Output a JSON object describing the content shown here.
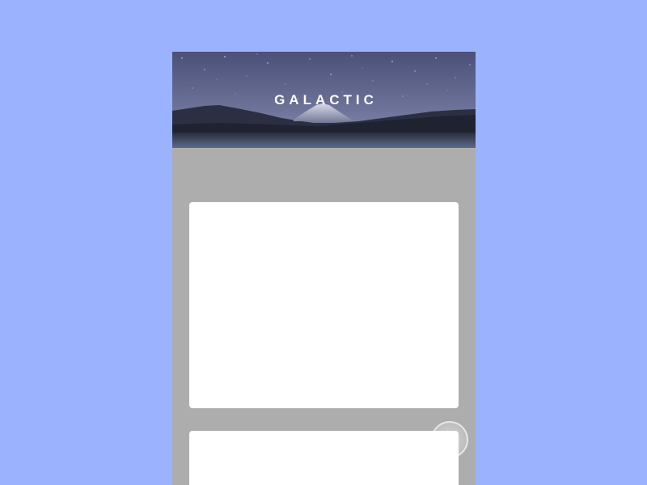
{
  "app": {
    "title": "GALACTIC"
  },
  "colors": {
    "background": "#9bb3ff",
    "phone_background": "#adadad",
    "card_background": "#ffffff",
    "title_color": "#ffffff"
  },
  "hero": {
    "image": "night-sky-mountain-image"
  },
  "cards": [
    {
      "name": "card-1"
    },
    {
      "name": "card-2"
    }
  ],
  "swipe_indicator": {
    "icon": "touch-circle-icon"
  }
}
